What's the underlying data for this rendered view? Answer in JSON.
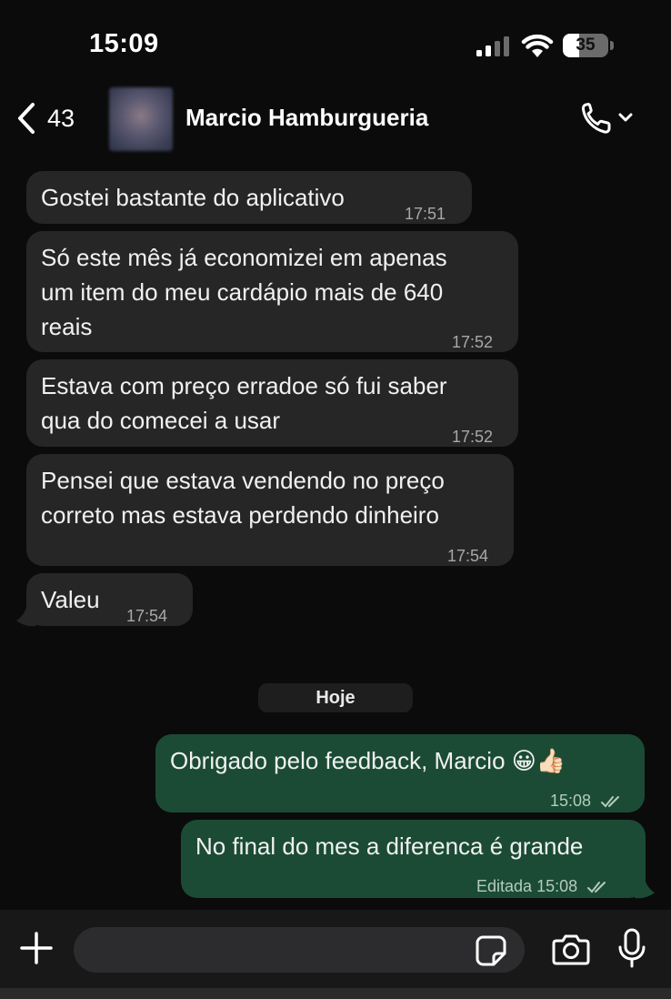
{
  "status_bar": {
    "time": "15:09",
    "battery": "35",
    "battery_level": 0.35
  },
  "header": {
    "back_count": "43",
    "contact_name": "Marcio Hamburgueria"
  },
  "messages": [
    {
      "direction": "in",
      "text": "Gostei bastante do aplicativo",
      "time": "17:51"
    },
    {
      "direction": "in",
      "lines": [
        "Só este mês já economizei em apenas",
        "um item do meu cardápio mais de 640",
        "reais"
      ],
      "time": "17:52"
    },
    {
      "direction": "in",
      "lines": [
        "Estava com preço erradoe só fui saber",
        "qua do comecei a usar"
      ],
      "time": "17:52"
    },
    {
      "direction": "in",
      "lines": [
        "Pensei que estava vendendo no preço",
        "correto  mas estava perdendo dinheiro"
      ],
      "time": "17:54"
    },
    {
      "direction": "in",
      "text": "Valeu",
      "time": "17:54"
    },
    {
      "direction": "out",
      "text": "Obrigado pelo feedback, Marcio 😀👍🏻",
      "time": "15:08",
      "status": "read"
    },
    {
      "direction": "out",
      "text": "No final do mes a diferenca é grande",
      "edited_label": "Editada",
      "time": "15:08",
      "status": "read"
    }
  ],
  "date_divider": "Hoje",
  "composer": {
    "placeholder": ""
  },
  "colors": {
    "incoming_bubble": "#262626",
    "outgoing_bubble": "#1b4b35",
    "background": "#0b0b0b"
  }
}
